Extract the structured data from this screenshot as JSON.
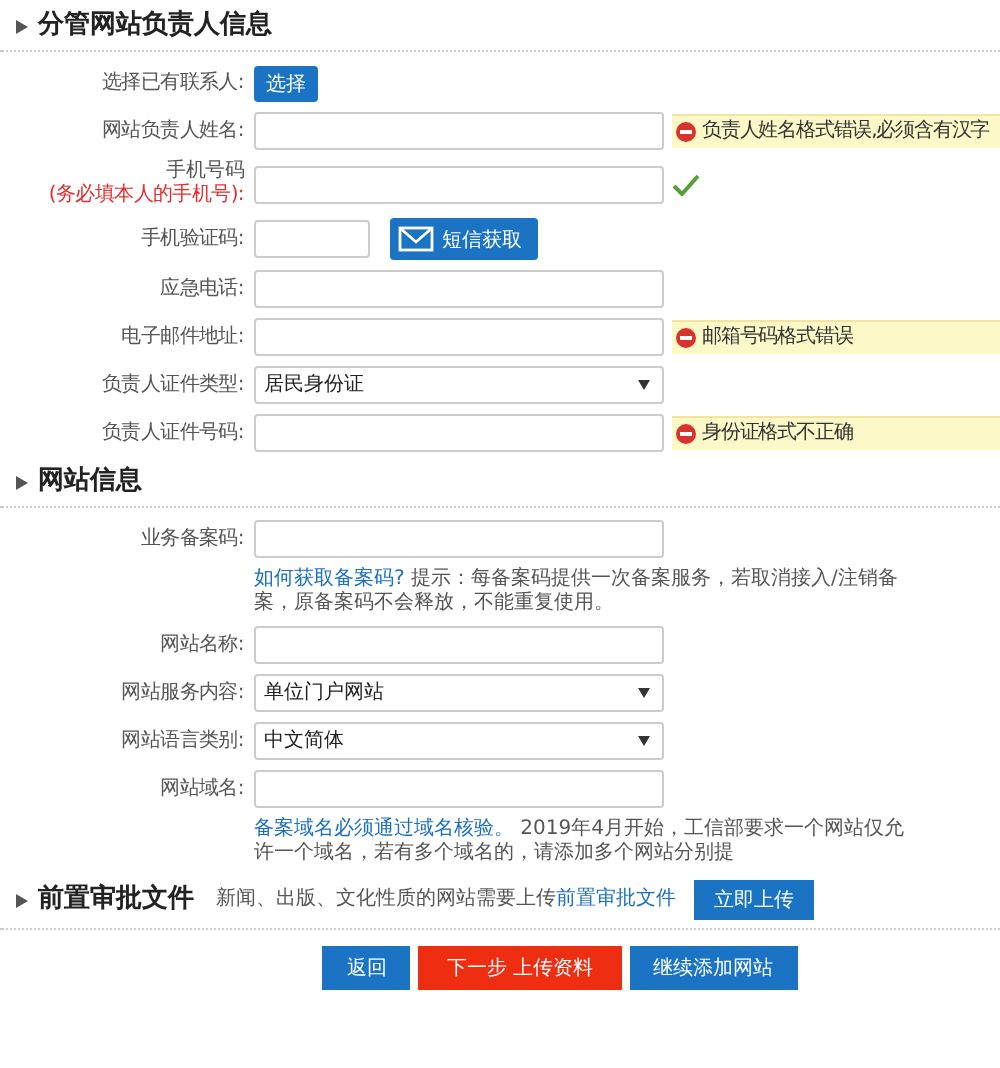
{
  "sections": [
    {
      "title": "分管网站负责人信息",
      "rows": [
        {
          "kind": "button",
          "label": "选择已有联系人:",
          "button": "选择"
        },
        {
          "kind": "text",
          "label": "网站负责人姓名:",
          "status": {
            "kind": "error",
            "text": "负责人姓名格式错误,必须含有汉字"
          }
        },
        {
          "kind": "text",
          "label": "手机号码",
          "label_note": "(务必填本人的手机号):",
          "status": {
            "kind": "ok"
          }
        },
        {
          "kind": "code",
          "label": "手机验证码:",
          "button": "短信获取"
        },
        {
          "kind": "text",
          "label": "应急电话:"
        },
        {
          "kind": "text",
          "label": "电子邮件地址:",
          "status": {
            "kind": "error",
            "text": "邮箱号码格式错误"
          }
        },
        {
          "kind": "select",
          "label": "负责人证件类型:",
          "value": "居民身份证"
        },
        {
          "kind": "text",
          "label": "负责人证件号码:",
          "status": {
            "kind": "error",
            "text": "身份证格式不正确"
          }
        }
      ]
    },
    {
      "title": "网站信息",
      "rows": [
        {
          "kind": "text",
          "label": "业务备案码:"
        },
        {
          "kind": "note",
          "link": "如何获取备案码?",
          "text": " 提示：每备案码提供一次备案服务，若取消接入/注销备案，原备案码不会释放，不能重复使用。"
        },
        {
          "kind": "text",
          "label": "网站名称:"
        },
        {
          "kind": "select",
          "label": "网站服务内容:",
          "value": "单位门户网站"
        },
        {
          "kind": "select",
          "label": "网站语言类别:",
          "value": "中文简体"
        },
        {
          "kind": "text",
          "label": "网站域名:"
        },
        {
          "kind": "note",
          "link": "备案域名必须通过域名核验。",
          "text": " 2019年4月开始，工信部要求一个网站仅允许一个域名，若有多个域名的，请添加多个网站分别提"
        }
      ]
    }
  ],
  "approval": {
    "title": "前置审批文件",
    "text": "新闻、出版、文化性质的网站需要上传",
    "link": "前置审批文件",
    "button": "立即上传"
  },
  "actions": [
    {
      "label": "返回",
      "kind": "normal"
    },
    {
      "label": "下一步 上传资料",
      "kind": "primary"
    },
    {
      "label": "继续添加网站",
      "kind": "normal"
    }
  ]
}
